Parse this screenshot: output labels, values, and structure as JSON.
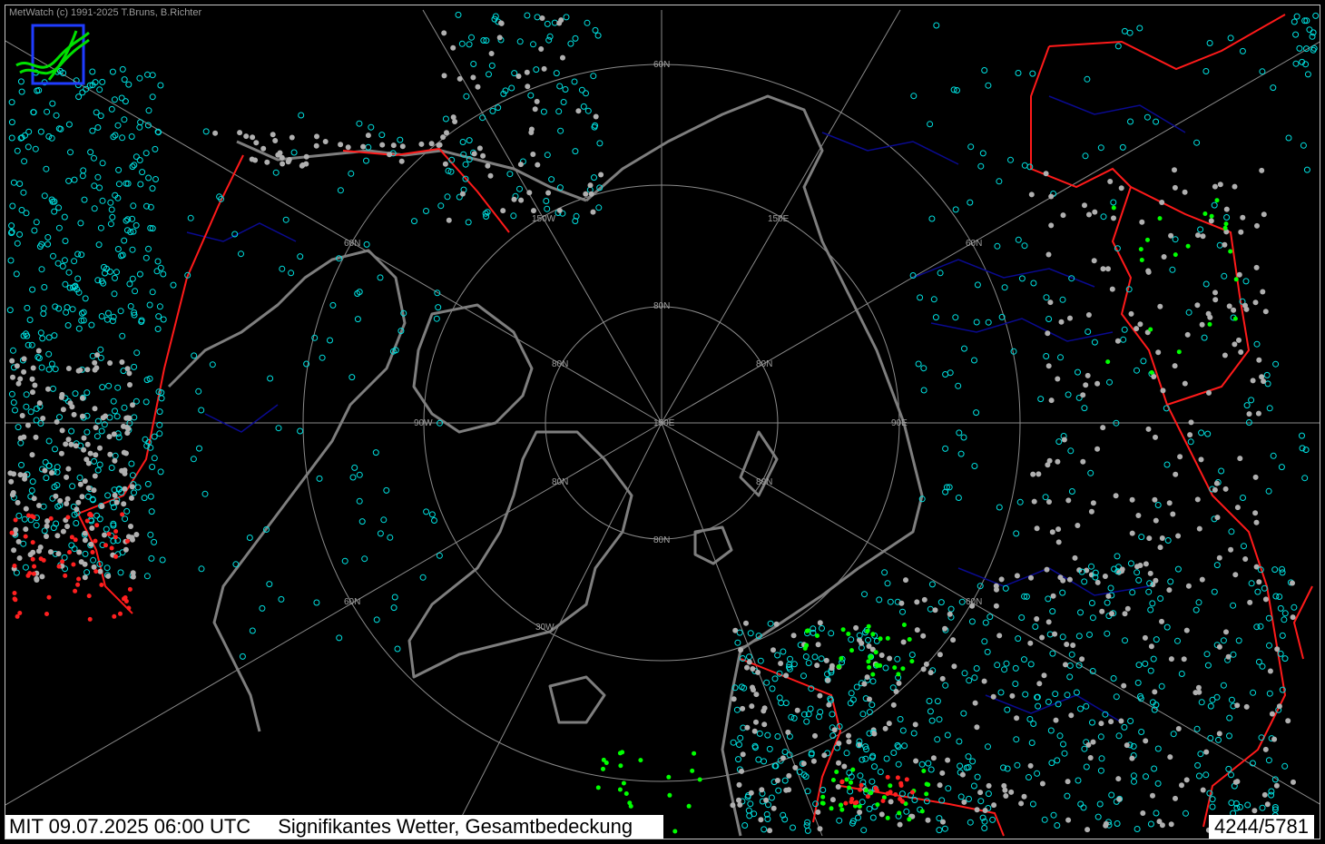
{
  "copyright": "MetWatch  (c) 1991-2025 T.Bruns, B.Richter",
  "status": {
    "datetime": "MIT 09.07.2025 06:00 UTC",
    "product": "Signifikantes Wetter, Gesamtbedeckung",
    "count": "4244/5781"
  },
  "grid_labels": {
    "lat60": "60N",
    "lat80": "80N",
    "lon150e": "150E",
    "lon90e": "90E",
    "lon90w": "90W",
    "lon150w": "150W",
    "lon30w": "30W",
    "pole": "150E"
  },
  "colors": {
    "background": "#000000",
    "coast": "#808080",
    "rivers": "#000080",
    "borders": "#ff0000",
    "grid": "#a0a0a0",
    "station_clear": "#00e0e0",
    "station_overcast": "#b0b0b0",
    "weather_green": "#00ff00",
    "weather_yellow": "#ffff00",
    "weather_red": "#ff2020"
  }
}
